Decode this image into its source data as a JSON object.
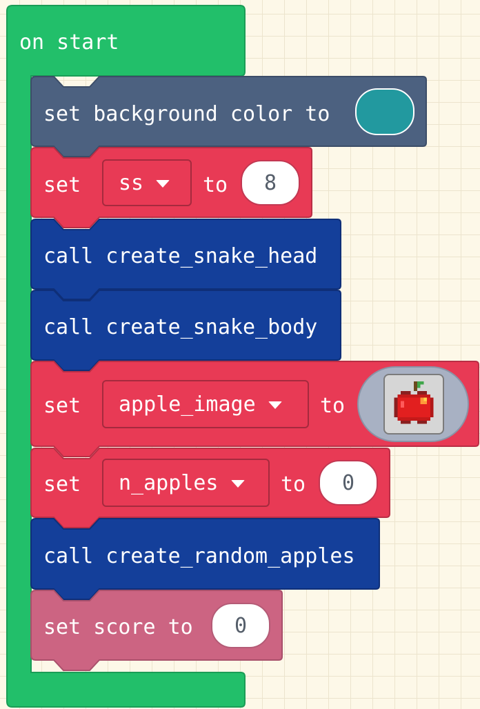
{
  "event_block": {
    "label": "on start"
  },
  "statements": [
    {
      "id": "set-bg",
      "kind": "set-background-color",
      "label": "set background color to",
      "value_color": "#22999f"
    },
    {
      "id": "set-ss",
      "kind": "set-variable",
      "set_label": "set",
      "variable": "ss",
      "to_label": "to",
      "value": "8"
    },
    {
      "id": "call-head",
      "kind": "call",
      "label": "call create_snake_head"
    },
    {
      "id": "call-body",
      "kind": "call",
      "label": "call create_snake_body"
    },
    {
      "id": "set-apple",
      "kind": "set-variable-image",
      "set_label": "set",
      "variable": "apple_image",
      "to_label": "to",
      "image_icon": "apple-icon"
    },
    {
      "id": "set-napples",
      "kind": "set-variable",
      "set_label": "set",
      "variable": "n_apples",
      "to_label": "to",
      "value": "0"
    },
    {
      "id": "call-apples",
      "kind": "call",
      "label": "call create_random_apples"
    },
    {
      "id": "set-score",
      "kind": "set-score",
      "label": "set score to",
      "value": "0"
    }
  ],
  "colors": {
    "event": "#22bf6a",
    "scene": "#4c6180",
    "variables": "#e83a55",
    "functions": "#143f9a",
    "info": "#cc6482",
    "canvas_bg": "#fdf8e8"
  }
}
